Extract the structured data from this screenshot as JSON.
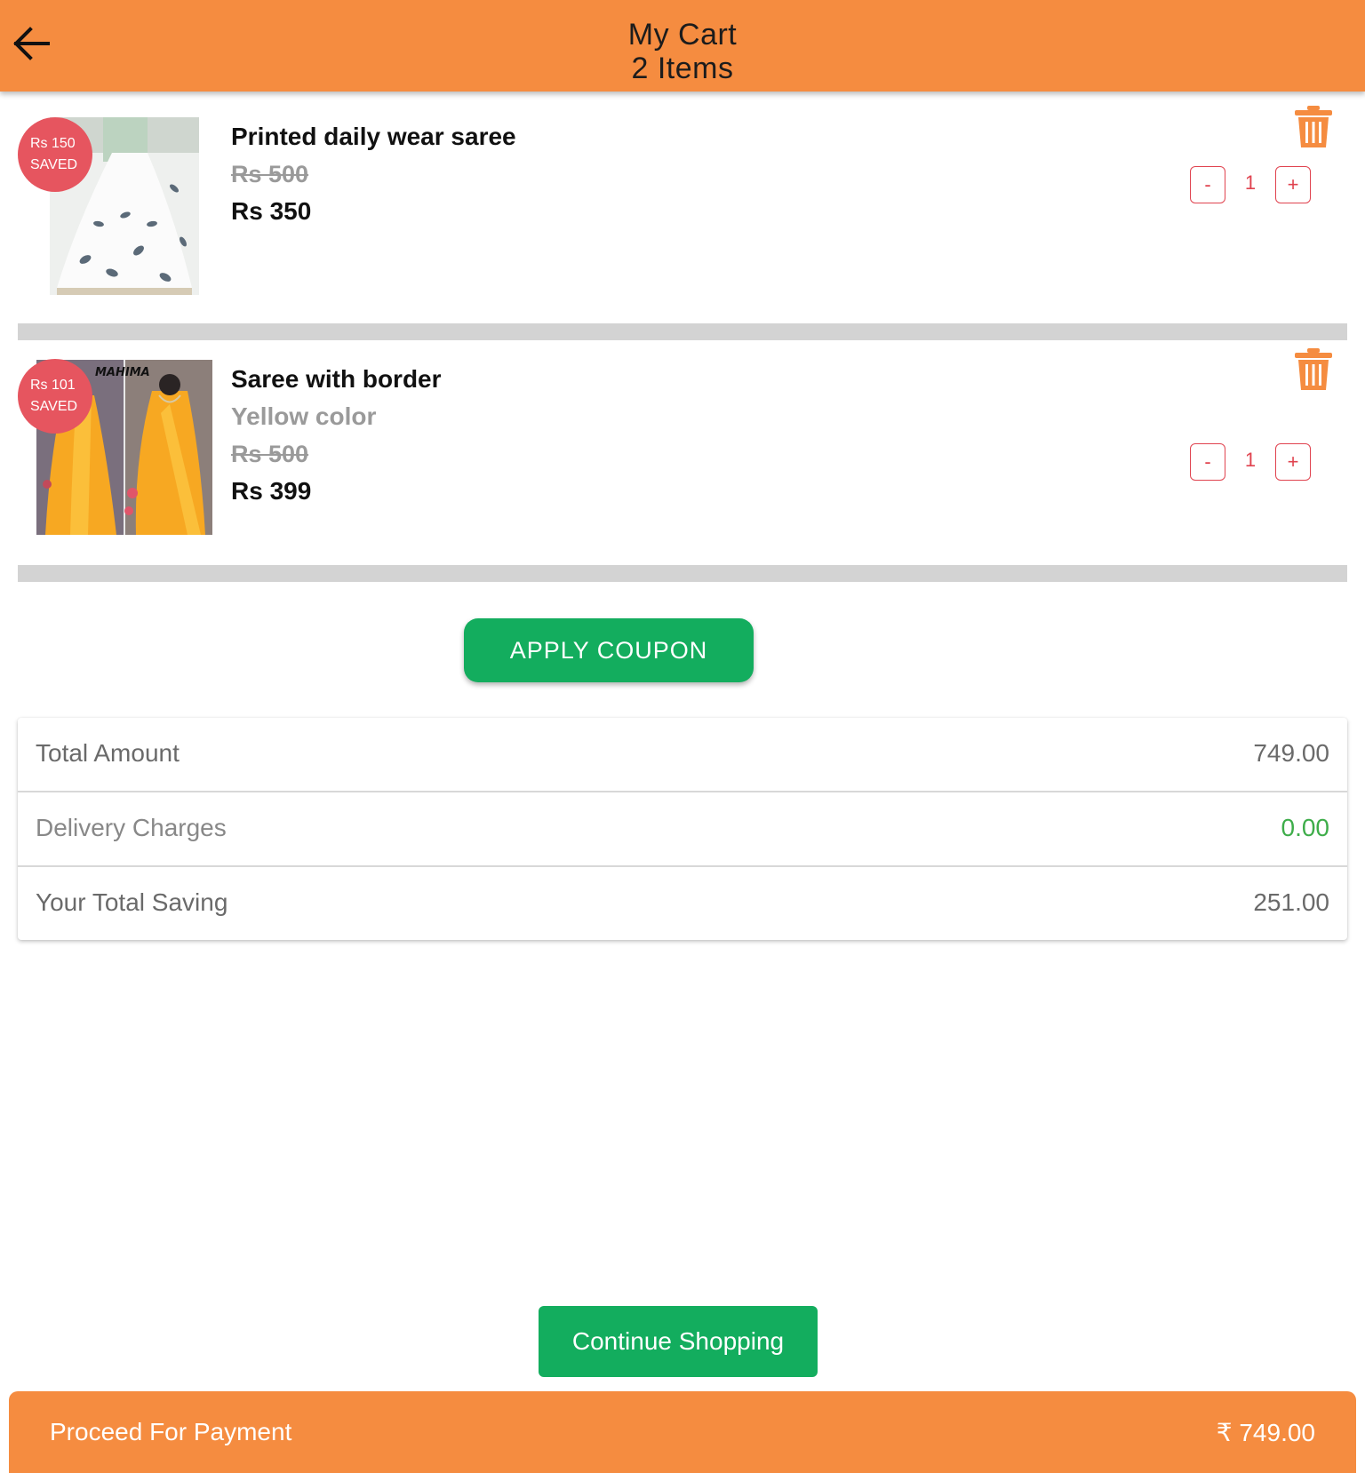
{
  "header": {
    "title": "My Cart",
    "subtitle": "2 Items",
    "back_icon": "arrow-left-icon",
    "background": "#f58c40"
  },
  "cart": {
    "items": [
      {
        "name": "Printed daily wear saree",
        "variant": "",
        "mrp": "Rs 500",
        "price": "Rs 350",
        "saved_amount": "Rs 150",
        "saved_label": "SAVED",
        "quantity": "1",
        "minus_label": "-",
        "plus_label": "+",
        "delete_icon": "trash-icon"
      },
      {
        "name": "Saree with border",
        "variant": "Yellow color",
        "mrp": "Rs 500",
        "price": "Rs 399",
        "saved_amount": "Rs 101",
        "saved_label": "SAVED",
        "quantity": "1",
        "minus_label": "-",
        "plus_label": "+",
        "delete_icon": "trash-icon",
        "image_brand_text": "MAHIMA"
      }
    ]
  },
  "coupon": {
    "button_label": "APPLY COUPON"
  },
  "summary": {
    "rows": [
      {
        "label": "Total Amount",
        "value": "749.00"
      },
      {
        "label": "Delivery Charges",
        "value": "0.00",
        "value_color": "#3ead4a"
      },
      {
        "label": "Your Total Saving",
        "value": "251.00"
      }
    ]
  },
  "actions": {
    "continue_label": "Continue Shopping",
    "proceed_label": "Proceed For Payment",
    "proceed_total": "₹ 749.00"
  },
  "colors": {
    "accent_orange": "#f58c40",
    "green": "#13ad5e",
    "badge_red": "#e6555f",
    "qty_red": "#e0434f"
  }
}
